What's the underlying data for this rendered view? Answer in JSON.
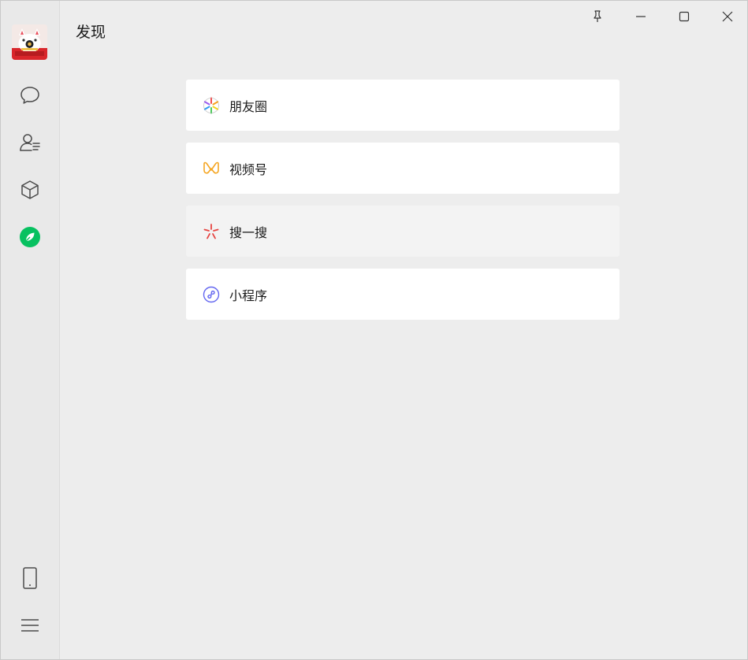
{
  "header": {
    "title": "发现"
  },
  "sidebar": {
    "avatar": "avatar-image",
    "top_icons": [
      "chat-bubble-icon",
      "contacts-icon",
      "cube-icon",
      "discover-compass-icon"
    ],
    "bottom_icons": [
      "phone-icon",
      "menu-icon"
    ],
    "active_color": "#07c160"
  },
  "titlebar": {
    "buttons": [
      "pin-icon",
      "minimize-icon",
      "maximize-icon",
      "close-icon"
    ]
  },
  "entries": [
    {
      "label": "朋友圈",
      "icon": "moments-icon"
    },
    {
      "label": "视频号",
      "icon": "channels-icon"
    },
    {
      "label": "搜一搜",
      "icon": "search-star-icon"
    },
    {
      "label": "小程序",
      "icon": "mini-program-icon"
    }
  ]
}
